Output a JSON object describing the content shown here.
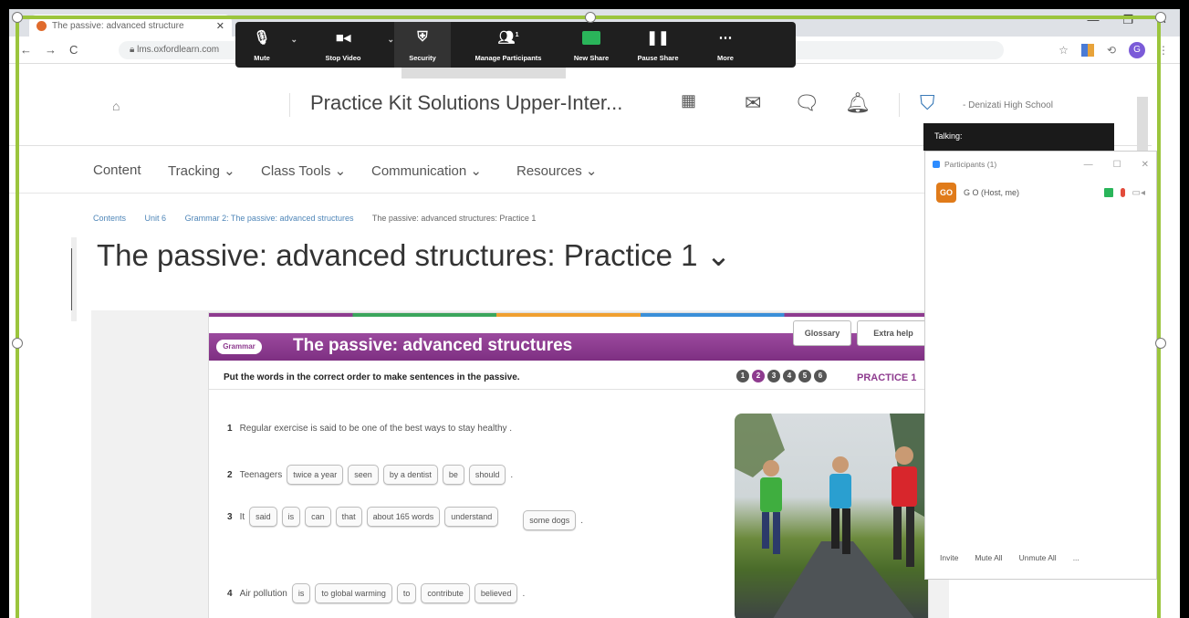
{
  "browser": {
    "tab_title": "The passive: advanced structure",
    "tab_close": "✕",
    "url": "lms.oxfordlearn.com",
    "window_controls": {
      "minimize": "—",
      "maximize": "❐",
      "close": "✕"
    },
    "nav": {
      "back": "←",
      "forward": "→",
      "reload": "C"
    }
  },
  "zoom_toolbar": {
    "mute": "Mute",
    "stop_video": "Stop Video",
    "security": "Security",
    "manage_participants": "Manage Participants",
    "participants_count": "1",
    "new_share": "New Share",
    "pause_share": "Pause Share",
    "more": "More"
  },
  "lms": {
    "course_title": "Practice Kit Solutions Upper-Inter...",
    "school": "- Denizati High School",
    "nav_items": [
      "Content",
      "Tracking ⌄",
      "Class Tools ⌄",
      "Communication ⌄",
      "Resources ⌄"
    ],
    "breadcrumb": [
      "Contents",
      "Unit 6",
      "Grammar 2: The passive: advanced structures",
      "The passive: advanced structures: Practice 1"
    ],
    "page_title": "The passive: advanced structures: Practice 1 ⌄"
  },
  "exercise": {
    "badge": "Grammar",
    "title": "The passive: advanced structures",
    "glossary": "Glossary",
    "extra_help": "Extra help",
    "instructions": "Put the words in the correct order to make sentences in the passive.",
    "steps": [
      "1",
      "2",
      "3",
      "4",
      "5",
      "6"
    ],
    "active_step": 2,
    "practice_label": "PRACTICE 1",
    "questions": [
      {
        "num": "1",
        "text": "Regular exercise is said to be one of the best ways to stay healthy .",
        "chips": []
      },
      {
        "num": "2",
        "text": "Teenagers",
        "chips": [
          "twice a year",
          "seen",
          "by a dentist",
          "be",
          "should"
        ],
        "end": "."
      },
      {
        "num": "3",
        "text": "It",
        "chips": [
          "said",
          "is",
          "can",
          "that",
          "about 165 words",
          "understand",
          "some dogs"
        ],
        "end": "."
      },
      {
        "num": "4",
        "text": "Air pollution",
        "chips": [
          "is",
          "to global warming",
          "to",
          "contribute",
          "believed"
        ],
        "end": "."
      }
    ]
  },
  "participants_panel": {
    "talking": "Talking:",
    "title": "Participants (1)",
    "participant": {
      "initials": "GO",
      "name": "G O (Host, me)"
    },
    "footer": [
      "Invite",
      "Mute All",
      "Unmute All",
      "..."
    ]
  },
  "colors": {
    "accent": "#8e3b8f",
    "zoom_bg": "#1f1f1f",
    "share_green": "#2ab55a",
    "border_green": "#9bc53d"
  }
}
